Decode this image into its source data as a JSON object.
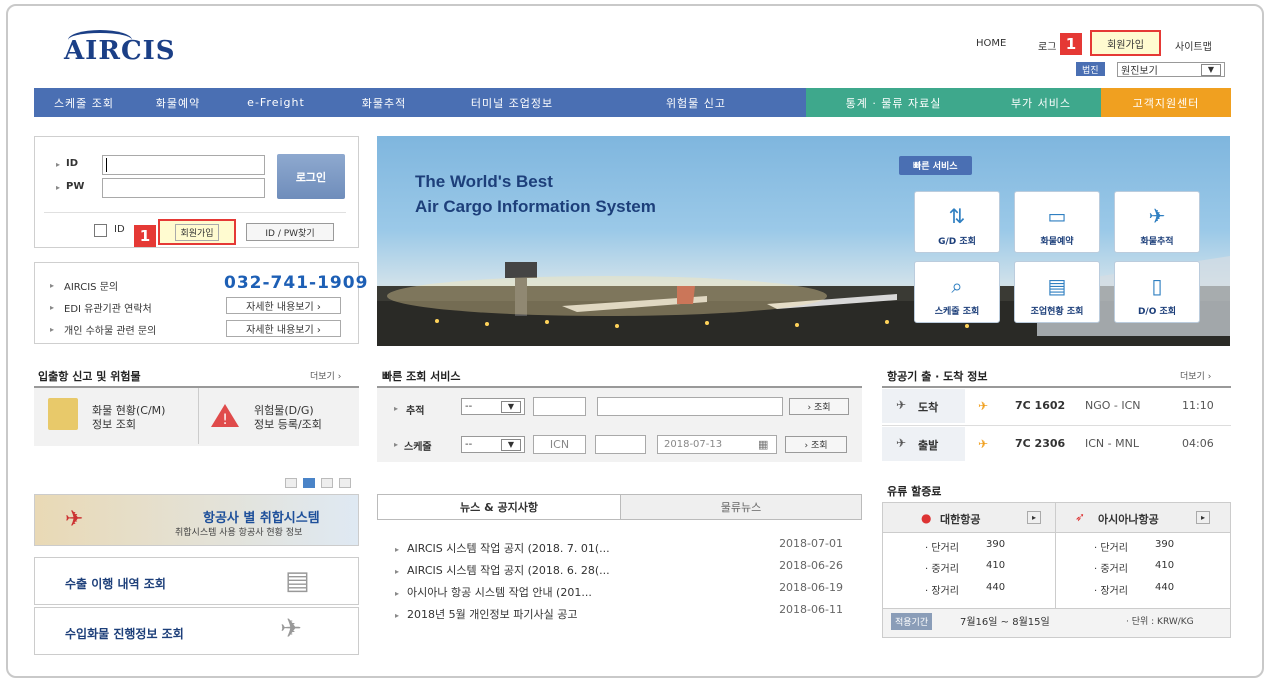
{
  "logo": "AIRCIS",
  "top_links": {
    "home": "HOME",
    "login_partial": "로그",
    "signup": "회원가입",
    "sitemap": "사이트맵",
    "lang_label": "법진",
    "lang_select": "원진보기"
  },
  "badges": {
    "top": "1",
    "login": "1"
  },
  "nav": [
    {
      "label": "스케줄 조회",
      "color": "#4a6fb3"
    },
    {
      "label": "화물예약",
      "color": "#4a6fb3"
    },
    {
      "label": "e-Freight",
      "color": "#4a6fb3"
    },
    {
      "label": "화물추적",
      "color": "#4a6fb3"
    },
    {
      "label": "터미널 조업정보",
      "color": "#4a6fb3"
    },
    {
      "label": "위험물 신고",
      "color": "#4a6fb3"
    },
    {
      "label": "통계 · 물류 자료실",
      "color": "#3ea88c"
    },
    {
      "label": "부가 서비스",
      "color": "#3ea88c"
    },
    {
      "label": "고객지원센터",
      "color": "#f0a020"
    }
  ],
  "login": {
    "id_label": "ID",
    "pw_label": "PW",
    "login_btn": "로그인",
    "save_id": "ID",
    "signup_btn": "회원가입",
    "find_btn": "ID / PW찾기"
  },
  "contact": {
    "aircis_q": "AIRCIS 문의",
    "phone": "032-741-1909",
    "edi": "EDI 유관기관 연락처",
    "detail1": "자세한 내용보기 ›",
    "personal": "개인 수하물 관련 문의",
    "detail2": "자세한 내용보기 ›"
  },
  "hero": {
    "line1": "The World's Best",
    "line2": "Air Cargo Information System",
    "quick_label": "빠른 서비스",
    "services": [
      "G/D 조회",
      "화물예약",
      "화물추적",
      "스케줄 조회",
      "조업현황 조회",
      "D/O 조회"
    ],
    "service_icons": [
      "gd-icon",
      "booking-icon",
      "tracking-plane-icon",
      "schedule-search-icon",
      "operation-status-icon",
      "do-document-icon"
    ]
  },
  "import_export": {
    "title": "입출항 신고 및 위험물",
    "more": "더보기 ›",
    "cm_line1": "화물 현황(C/M)",
    "cm_line2": "정보 조회",
    "dg_line1": "위험물(D/G)",
    "dg_line2": "정보 등록/조회"
  },
  "banners": {
    "airline_title": "항공사 별 취합시스템",
    "airline_sub": "취합시스템 사용 항공사 현황 정보",
    "export": "수출 이행 내역 조회",
    "import": "수입화물 진행정보 조회"
  },
  "quick_search": {
    "title": "빠른 조회 서비스",
    "track_label": "추적",
    "sched_label": "스케줄",
    "dash": "--",
    "origin": "ICN",
    "date": "2018-07-13",
    "search_btn": "› 조회"
  },
  "news": {
    "tab1": "뉴스 & 공지사항",
    "tab2": "물류뉴스",
    "items": [
      {
        "title": "AIRCIS 시스템 작업 공지 (2018. 7. 01(...",
        "date": "2018-07-01"
      },
      {
        "title": "AIRCIS 시스템 작업 공지 (2018. 6. 28(...",
        "date": "2018-06-26"
      },
      {
        "title": "아시아나 항공 시스템 작업 안내 (201...",
        "date": "2018-06-19"
      },
      {
        "title": "2018년 5월 개인정보 파기사실 공고",
        "date": "2018-06-11"
      }
    ]
  },
  "flights": {
    "title": "항공기 출 · 도착 정보",
    "more": "더보기 ›",
    "arrival": {
      "label": "도착",
      "flight": "7C 1602",
      "route": "NGO - ICN",
      "time": "11:10"
    },
    "departure": {
      "label": "출발",
      "flight": "7C 2306",
      "route": "ICN - MNL",
      "time": "04:06"
    }
  },
  "fuel": {
    "title": "유류 할증료",
    "korean": "대한항공",
    "asiana": "아시아나항공",
    "rows": [
      {
        "label": "· 단거리",
        "k": "390",
        "a": "390"
      },
      {
        "label": "· 중거리",
        "k": "410",
        "a": "410"
      },
      {
        "label": "· 장거리",
        "k": "440",
        "a": "440"
      }
    ],
    "period_label": "적용기간",
    "period": "7월16일 ~ 8월15일",
    "unit": "· 단위 : KRW/KG"
  }
}
